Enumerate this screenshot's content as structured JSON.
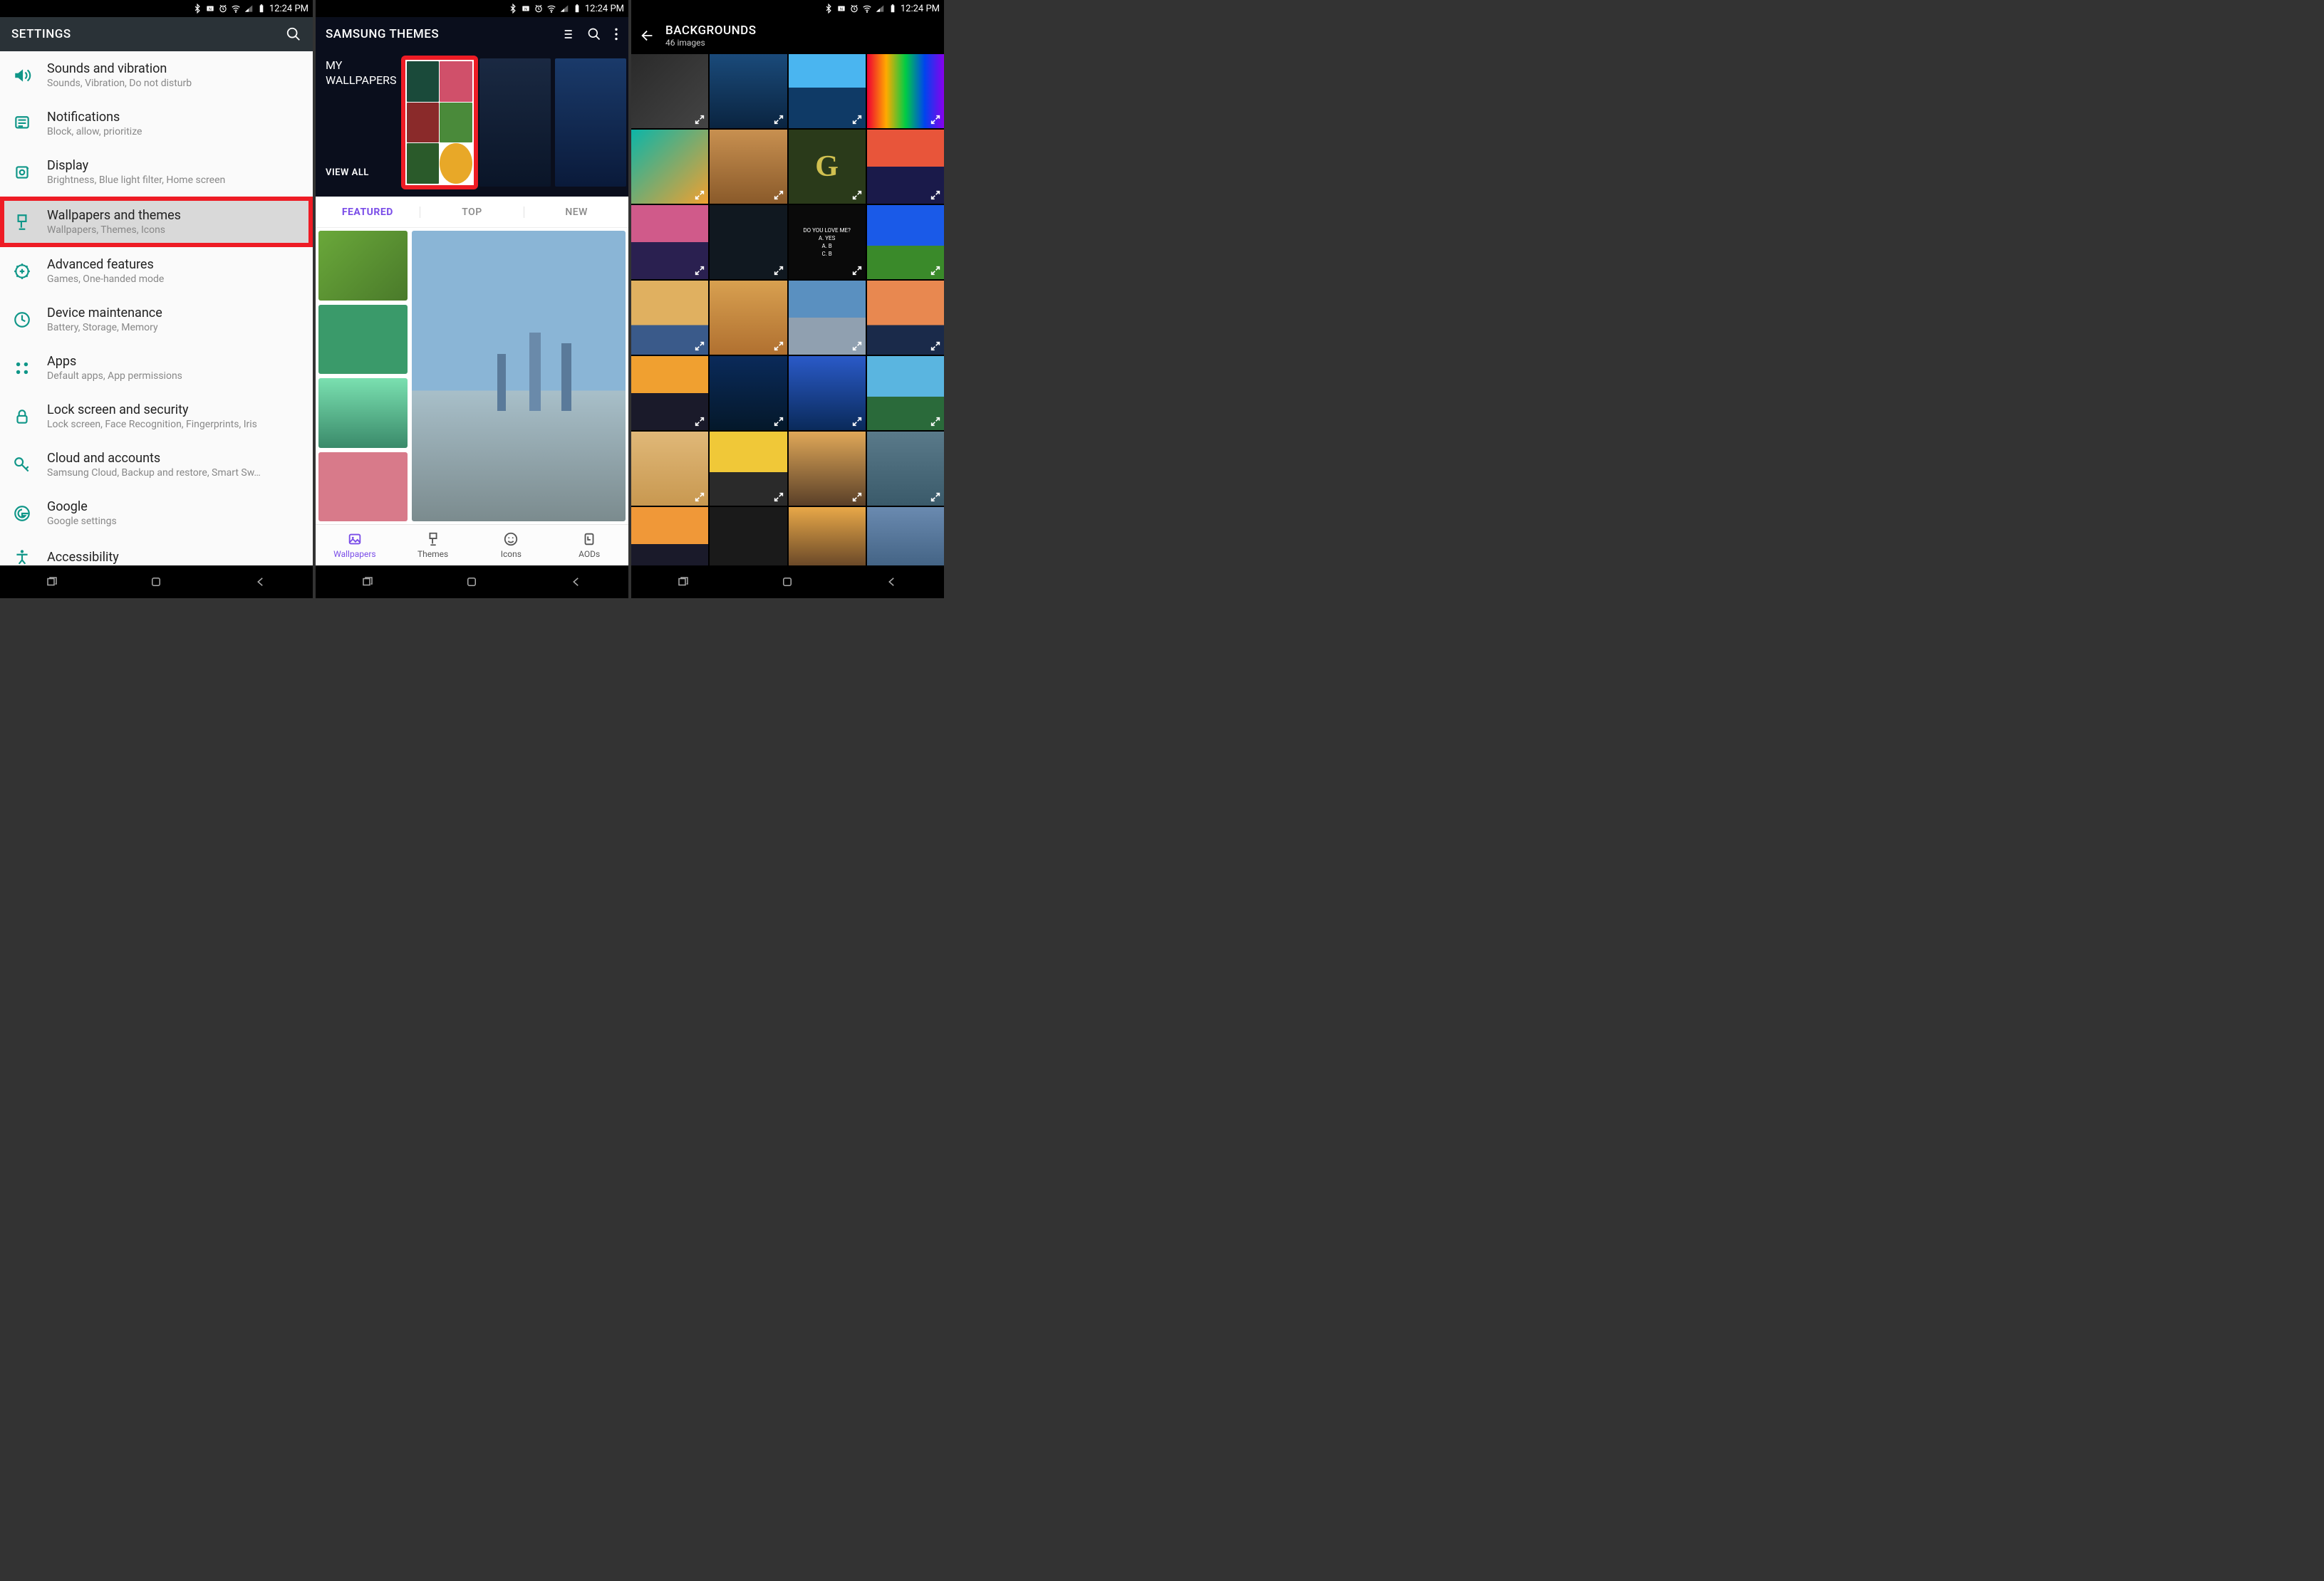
{
  "status": {
    "time": "12:24 PM"
  },
  "screen1": {
    "header": "SETTINGS",
    "items": [
      {
        "icon": "speaker",
        "title": "Sounds and vibration",
        "sub": "Sounds, Vibration, Do not disturb",
        "hl": false
      },
      {
        "icon": "bell",
        "title": "Notifications",
        "sub": "Block, allow, prioritize",
        "hl": false
      },
      {
        "icon": "sun",
        "title": "Display",
        "sub": "Brightness, Blue light filter, Home screen",
        "hl": false
      },
      {
        "icon": "brush",
        "title": "Wallpapers and themes",
        "sub": "Wallpapers, Themes, Icons",
        "hl": true
      },
      {
        "icon": "gear-plus",
        "title": "Advanced features",
        "sub": "Games, One-handed mode",
        "hl": false
      },
      {
        "icon": "circle",
        "title": "Device maintenance",
        "sub": "Battery, Storage, Memory",
        "hl": false
      },
      {
        "icon": "apps",
        "title": "Apps",
        "sub": "Default apps, App permissions",
        "hl": false
      },
      {
        "icon": "lock",
        "title": "Lock screen and security",
        "sub": "Lock screen, Face Recognition, Fingerprints, Iris",
        "hl": false
      },
      {
        "icon": "key",
        "title": "Cloud and accounts",
        "sub": "Samsung Cloud, Backup and restore, Smart Sw…",
        "hl": false
      },
      {
        "icon": "google",
        "title": "Google",
        "sub": "Google settings",
        "hl": false
      },
      {
        "icon": "accessibility",
        "title": "Accessibility",
        "sub": "",
        "hl": false
      }
    ]
  },
  "screen2": {
    "header": "SAMSUNG THEMES",
    "my_label_1": "MY",
    "my_label_2": "WALLPAPERS",
    "view_all": "VIEW ALL",
    "tabs": [
      {
        "label": "FEATURED",
        "active": true
      },
      {
        "label": "TOP",
        "active": false
      },
      {
        "label": "NEW",
        "active": false
      }
    ],
    "bottom_nav": [
      {
        "label": "Wallpapers",
        "active": true
      },
      {
        "label": "Themes",
        "active": false
      },
      {
        "label": "Icons",
        "active": false
      },
      {
        "label": "AODs",
        "active": false
      }
    ]
  },
  "screen3": {
    "header": "BACKGROUNDS",
    "sub": "46 images",
    "text_tile": {
      "l1": "DO YOU LOVE ME?",
      "l2": "A. YES",
      "l3": "A. B",
      "l4": "C. B"
    },
    "g_logo": "G",
    "thumbs": [
      "th1",
      "th2",
      "th3",
      "th4",
      "th5",
      "th6",
      "g",
      "th8",
      "th9",
      "th10",
      "txt",
      "th12",
      "th13",
      "th14",
      "th15",
      "th16",
      "th17",
      "th18",
      "th19",
      "th20",
      "th21",
      "th22",
      "th23",
      "th24",
      "th25",
      "th26",
      "th27",
      "th28"
    ]
  }
}
